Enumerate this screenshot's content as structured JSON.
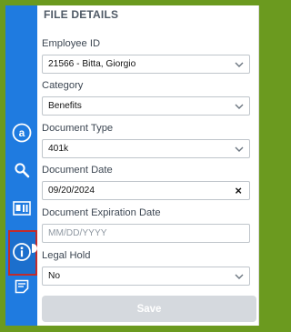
{
  "panel": {
    "title": "FILE DETAILS"
  },
  "fields": {
    "employee_id": {
      "label": "Employee ID",
      "value": "21566 - Bitta, Giorgio"
    },
    "category": {
      "label": "Category",
      "value": "Benefits"
    },
    "document_type": {
      "label": "Document Type",
      "value": "401k"
    },
    "document_date": {
      "label": "Document Date",
      "value": "09/20/2024",
      "clear": "×"
    },
    "expiration_date": {
      "label": "Document Expiration Date",
      "placeholder": "MM/DD/YYYY"
    },
    "legal_hold": {
      "label": "Legal Hold",
      "value": "No"
    }
  },
  "actions": {
    "save_label": "Save"
  },
  "sidebar": {
    "icons": [
      "at-sign-icon",
      "search-person-icon",
      "id-card-icon",
      "info-icon",
      "notes-icon"
    ],
    "active": "info-icon"
  },
  "colors": {
    "frame": "#6b9a1f",
    "sidebar": "#1f7be0",
    "active_border": "#c22b2b",
    "save_disabled": "#d5d9de"
  }
}
